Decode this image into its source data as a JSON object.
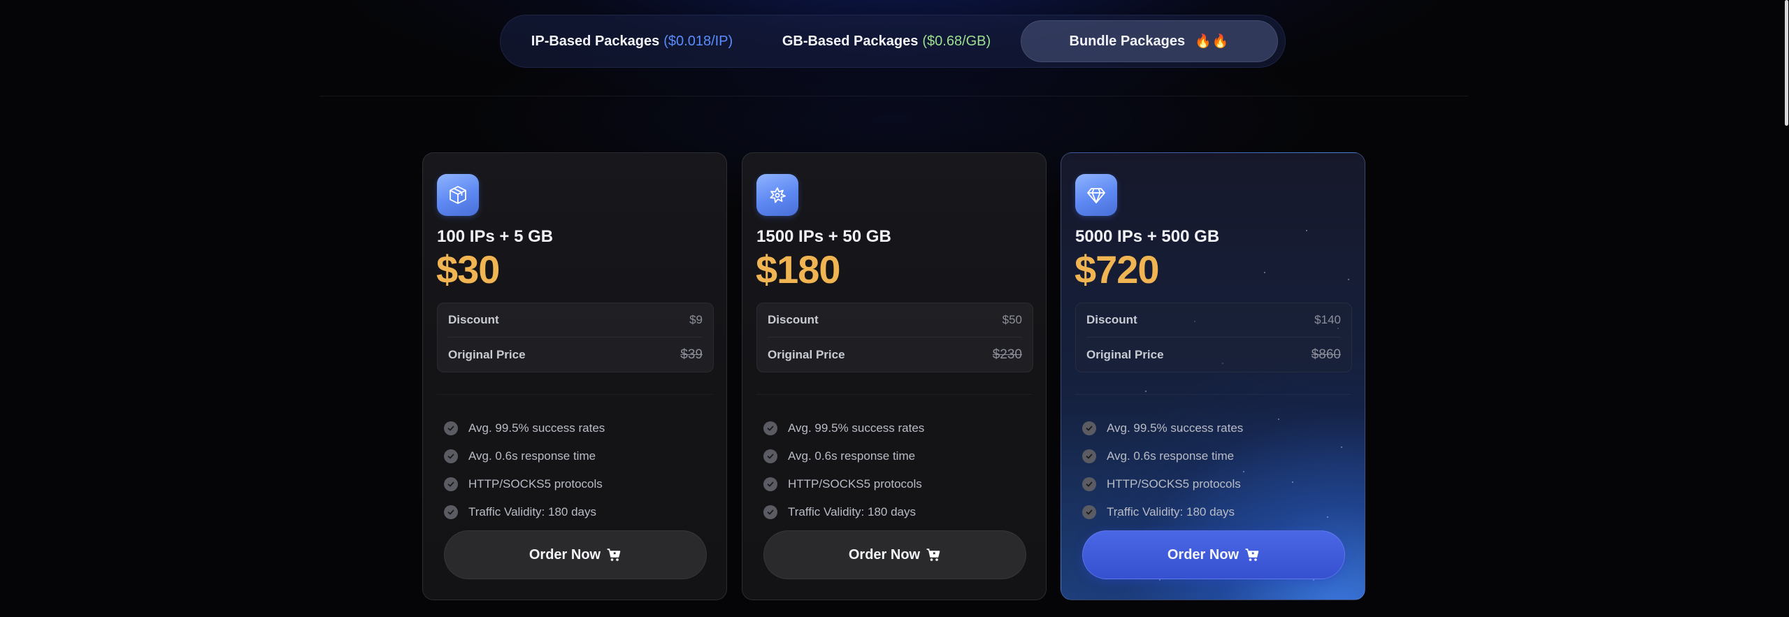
{
  "tabs": [
    {
      "label": "IP-Based Packages",
      "price": "($0.018/IP)",
      "price_color": "#5b8cff"
    },
    {
      "label": "GB-Based Packages",
      "price": "($0.68/GB)",
      "price_color": "#9ce08f"
    },
    {
      "label": "Bundle Packages",
      "badge": "🔥🔥",
      "active": true
    }
  ],
  "packages": [
    {
      "icon": "cube-icon",
      "title": "100 IPs + 5 GB",
      "price": "$30",
      "discount_label": "Discount",
      "discount": "$9",
      "original_label": "Original Price",
      "original_price": "$39",
      "features": [
        "Avg. 99.5% success rates",
        "Avg. 0.6s response time",
        "HTTP/SOCKS5 protocols",
        "Traffic Validity: 180 days"
      ],
      "button": "Order Now"
    },
    {
      "icon": "sparkle-gear-icon",
      "title": "1500 IPs + 50 GB",
      "price": "$180",
      "discount_label": "Discount",
      "discount": "$50",
      "original_label": "Original Price",
      "original_price": "$230",
      "features": [
        "Avg. 99.5% success rates",
        "Avg. 0.6s response time",
        "HTTP/SOCKS5 protocols",
        "Traffic Validity: 180 days"
      ],
      "button": "Order Now"
    },
    {
      "icon": "diamond-icon",
      "title": "5000 IPs + 500 GB",
      "price": "$720",
      "discount_label": "Discount",
      "discount": "$140",
      "original_label": "Original Price",
      "original_price": "$860",
      "features": [
        "Avg. 99.5% success rates",
        "Avg. 0.6s response time",
        "HTTP/SOCKS5 protocols",
        "Traffic Validity: 180 days"
      ],
      "button": "Order Now",
      "highlighted": true
    }
  ],
  "colors": {
    "accent": "#f0b552",
    "primary_button": "#3f5bdc",
    "icon_bg": "#6b93f5"
  }
}
